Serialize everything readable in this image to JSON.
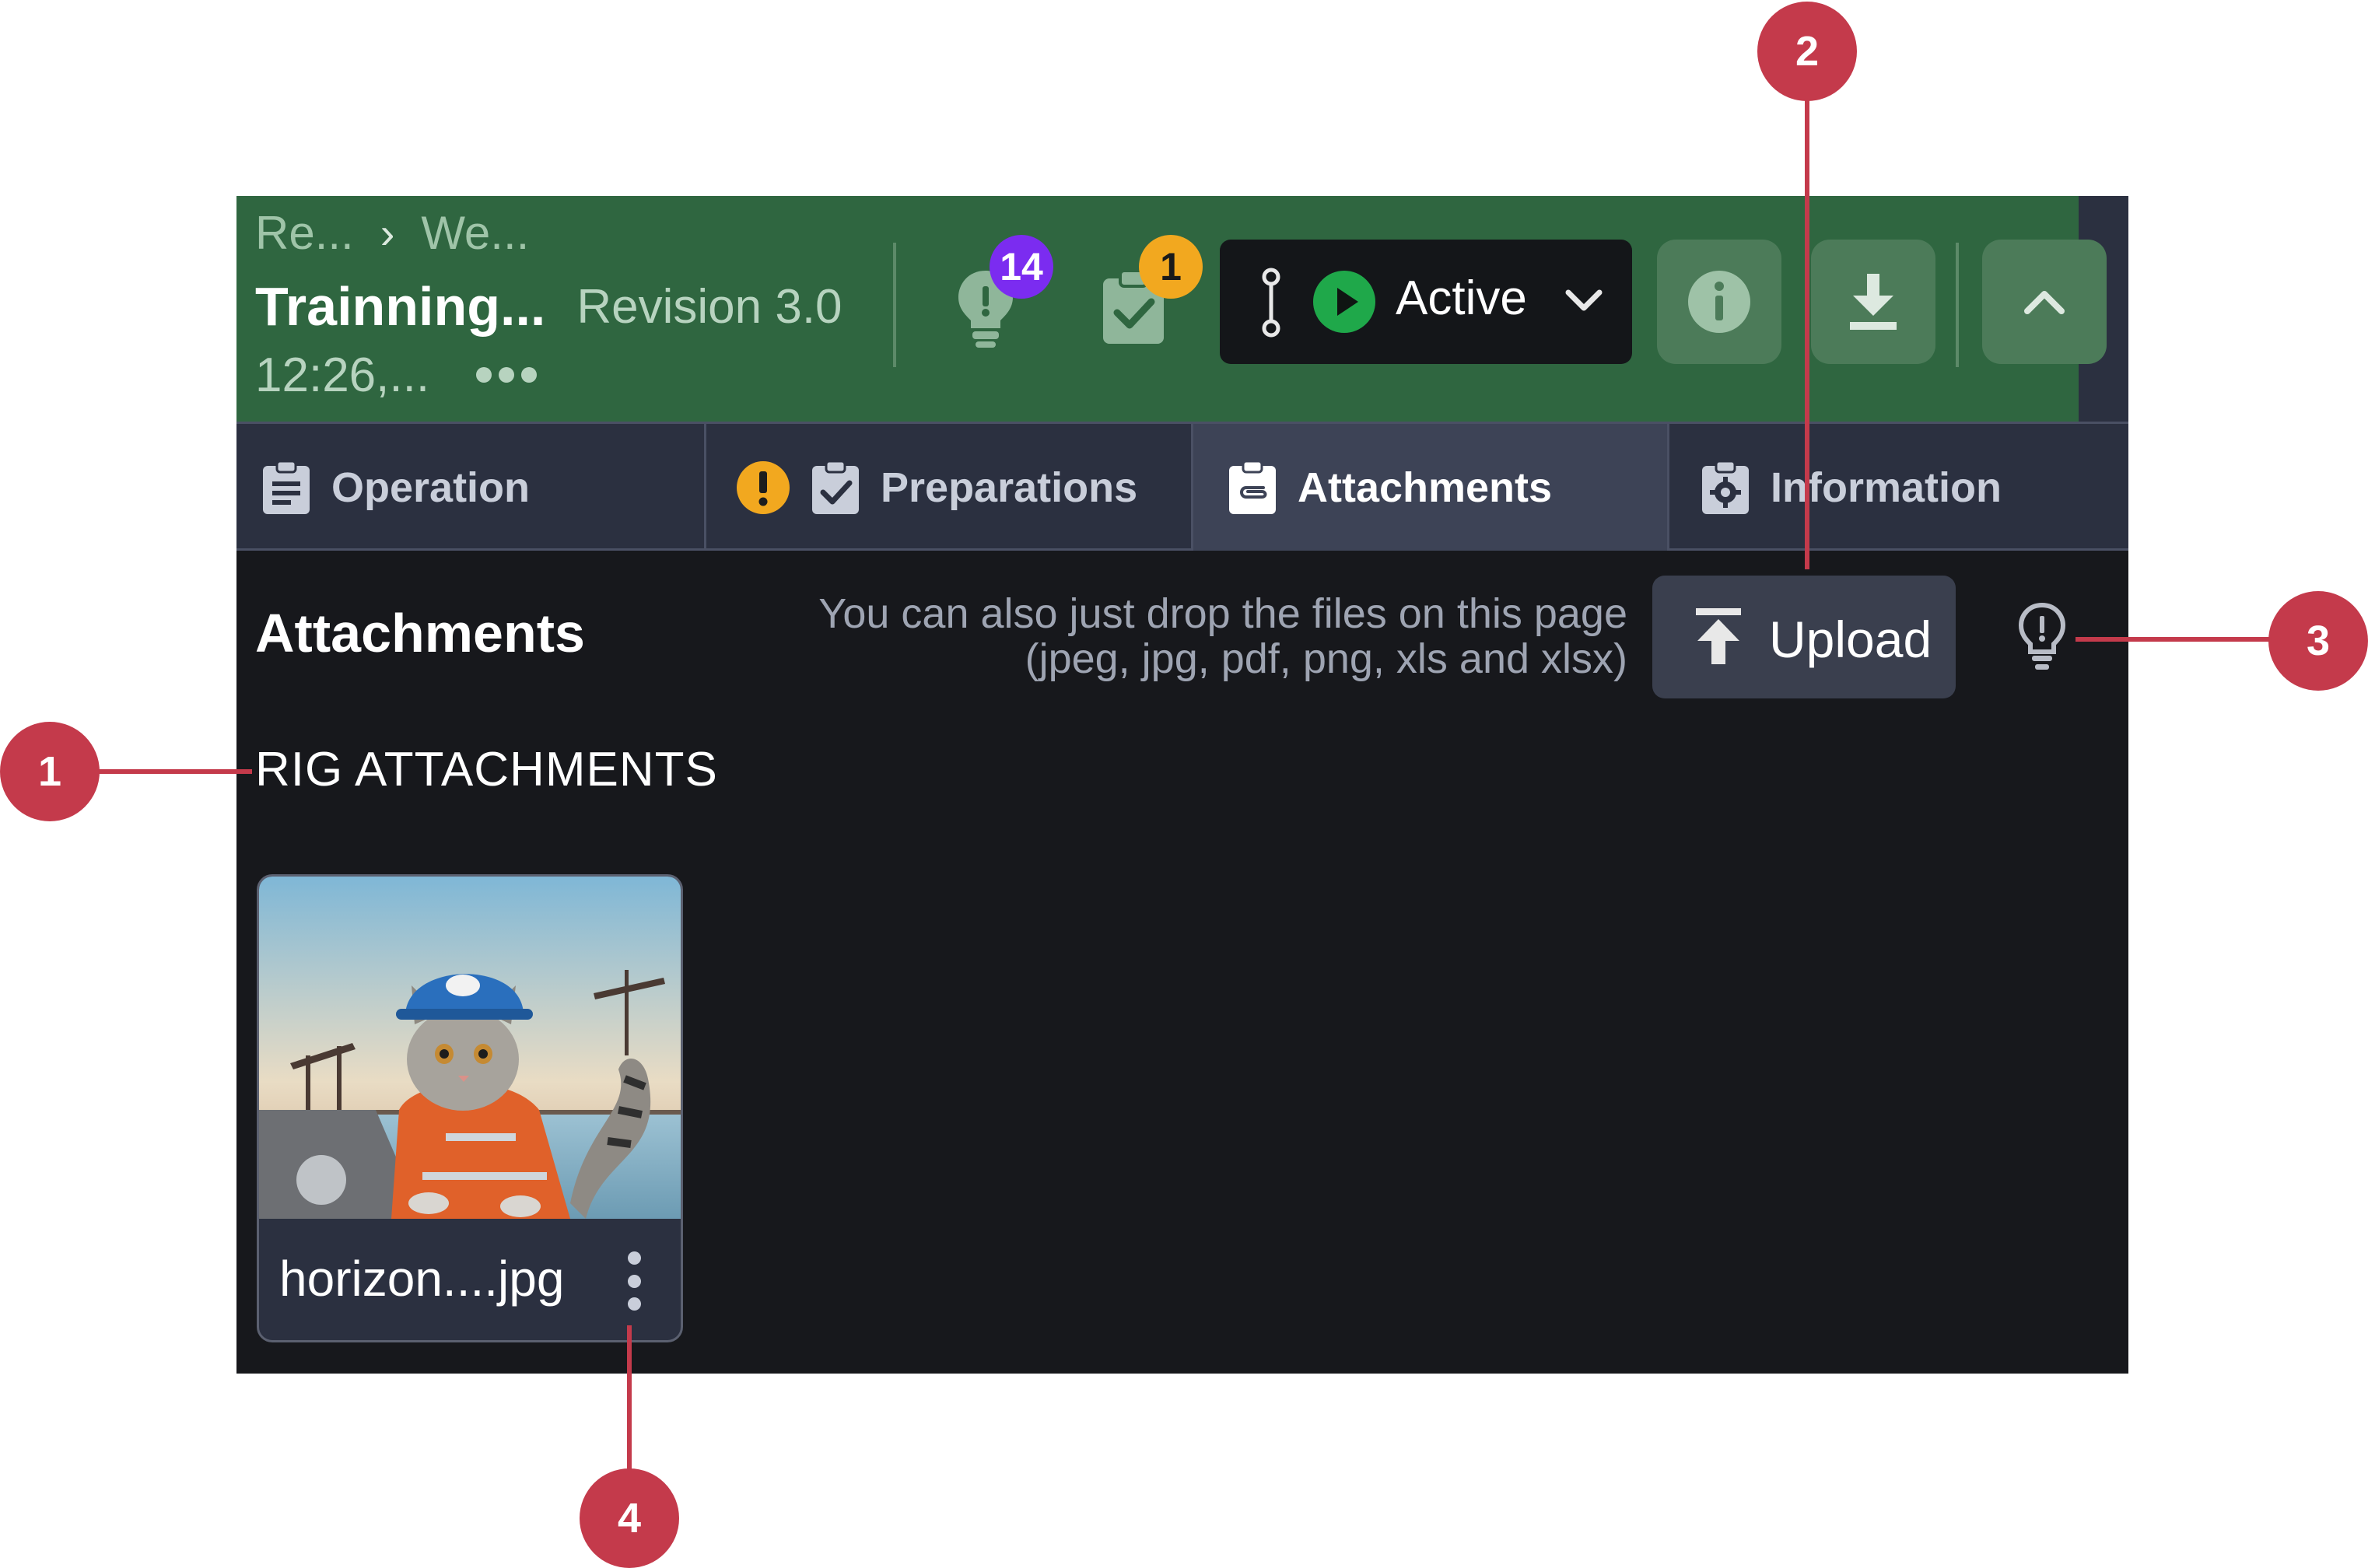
{
  "header": {
    "breadcrumb": [
      "Re...",
      "We..."
    ],
    "breadcrumb_separator": "›",
    "title": "Trainning...",
    "revision": "Revision 3.0",
    "time": "12:26,...",
    "lightbulb_badge": "14",
    "checklist_badge": "1",
    "status_label": "Active",
    "colors": {
      "header_bg": "#2f6640",
      "status_play": "#1fa84a",
      "badge_purple": "#7b2cf0",
      "badge_orange": "#f2a81f"
    }
  },
  "tabs": [
    {
      "label": "Operation",
      "icon": "clipboard-list-icon",
      "active": false
    },
    {
      "label": "Preparations",
      "icon": "clipboard-check-icon",
      "warning": true,
      "active": false
    },
    {
      "label": "Attachments",
      "icon": "clipboard-paperclip-icon",
      "active": true
    },
    {
      "label": "Information",
      "icon": "clipboard-gear-icon",
      "active": false
    }
  ],
  "attachments": {
    "title": "Attachments",
    "drop_hint_line1": "You can also just drop the files on this page",
    "drop_hint_line2": "(jpeg, jpg, pdf, png, xls and xlsx)",
    "upload_label": "Upload",
    "group_label": "RIG ATTACHMENTS",
    "files": [
      {
        "name": "horizon....jpg",
        "thumbnail": "cat-in-hardhat-oil-rig-image"
      }
    ]
  },
  "callouts": [
    "1",
    "2",
    "3",
    "4"
  ],
  "callout_color": "#c43a4b"
}
